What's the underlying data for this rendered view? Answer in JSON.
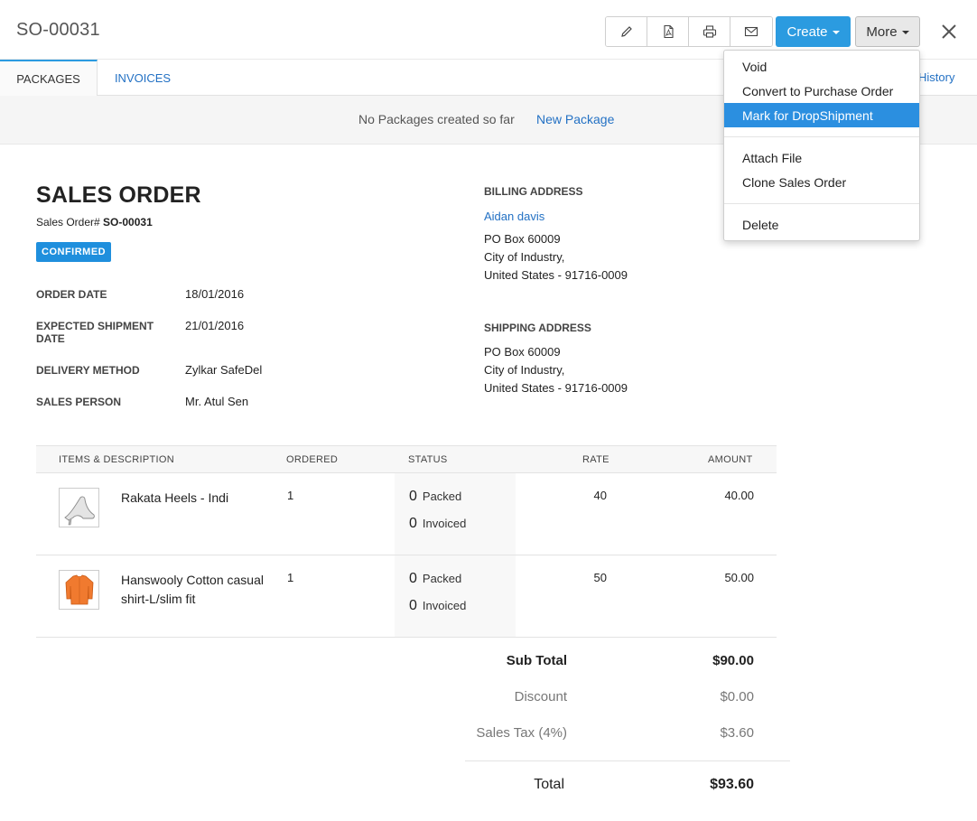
{
  "header": {
    "title": "SO-00031",
    "create_label": "Create",
    "more_label": "More",
    "icons": [
      "pencil-icon",
      "pdf-icon",
      "print-icon",
      "mail-icon",
      "close-icon"
    ]
  },
  "tabs": [
    {
      "label": "PACKAGES"
    },
    {
      "label": "INVOICES"
    }
  ],
  "history_label": "History",
  "packages": {
    "empty_text": "No Packages created so far",
    "new_label": "New Package"
  },
  "order": {
    "heading": "SALES ORDER",
    "number_label": "Sales Order#",
    "number": "SO-00031",
    "status": "CONFIRMED",
    "fields": [
      {
        "label": "ORDER DATE",
        "value": "18/01/2016"
      },
      {
        "label": "EXPECTED SHIPMENT DATE",
        "value": "21/01/2016"
      },
      {
        "label": "DELIVERY METHOD",
        "value": "Zylkar SafeDel"
      },
      {
        "label": "SALES PERSON",
        "value": "Mr. Atul Sen"
      }
    ]
  },
  "billing": {
    "label": "BILLING ADDRESS",
    "name": "Aidan davis",
    "lines": [
      "PO Box 60009",
      "City of Industry,",
      "United States - 91716-0009"
    ]
  },
  "shipping": {
    "label": "SHIPPING ADDRESS",
    "lines": [
      "PO Box 60009",
      "City of Industry,",
      "United States - 91716-0009"
    ]
  },
  "table": {
    "columns": [
      "ITEMS & DESCRIPTION",
      "ORDERED",
      "STATUS",
      "RATE",
      "AMOUNT"
    ],
    "rows": [
      {
        "name": "Rakata Heels - Indi",
        "ordered": "1",
        "packed": "0",
        "packed_label": "Packed",
        "invoiced": "0",
        "invoiced_label": "Invoiced",
        "rate": "40",
        "amount": "40.00",
        "thumb": "heel-shoe-icon"
      },
      {
        "name": "Hanswooly Cotton casual shirt-L/slim fit",
        "ordered": "1",
        "packed": "0",
        "packed_label": "Packed",
        "invoiced": "0",
        "invoiced_label": "Invoiced",
        "rate": "50",
        "amount": "50.00",
        "thumb": "shirt-icon"
      }
    ]
  },
  "totals": {
    "sub_total_label": "Sub Total",
    "sub_total": "$90.00",
    "discount_label": "Discount",
    "discount": "$0.00",
    "tax_label": "Sales Tax (4%)",
    "tax": "$3.60",
    "total_label": "Total",
    "total": "$93.60"
  },
  "more_menu": {
    "items": [
      "Void",
      "Convert to Purchase Order",
      "Mark for DropShipment",
      "Attach File",
      "Clone Sales Order",
      "Delete"
    ],
    "active": "Mark for DropShipment"
  },
  "colors": {
    "accent": "#2b9be0",
    "link": "#2371c4",
    "badge": "#1f8fdd"
  }
}
